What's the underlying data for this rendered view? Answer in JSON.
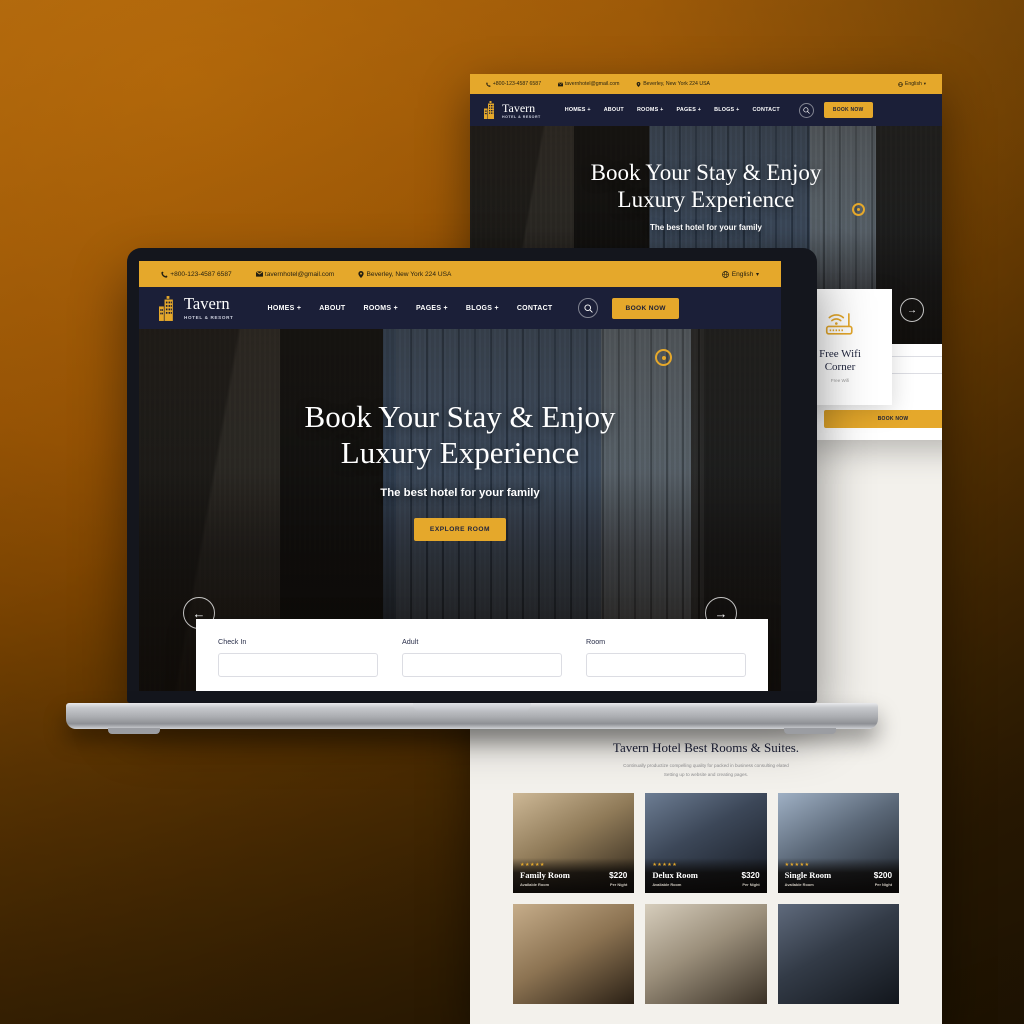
{
  "canvas": {
    "background_top": "#c8920f",
    "background_bottom": "#6b5418"
  },
  "brand": {
    "name": "Tavern",
    "tagline": "HOTEL & RESORT",
    "accent_color": "#e5a82b",
    "navy_color": "#1b1f38"
  },
  "topbar": {
    "phone": "+800-123-4587 6587",
    "email": "tavernhotel@gmail.com",
    "address": "Beverley, New York 224 USA",
    "language": "English",
    "phone_icon": "phone-icon",
    "email_icon": "envelope-icon",
    "address_icon": "map-pin-icon",
    "language_icon": "globe-icon",
    "language_caret": "chevron-down-icon"
  },
  "nav": {
    "items": [
      {
        "label": "HOMES",
        "has_submenu": true
      },
      {
        "label": "ABOUT",
        "has_submenu": false
      },
      {
        "label": "ROOMS",
        "has_submenu": true
      },
      {
        "label": "PAGES",
        "has_submenu": true
      },
      {
        "label": "BLOGS",
        "has_submenu": true
      },
      {
        "label": "CONTACT",
        "has_submenu": false
      }
    ],
    "search_icon": "search-icon",
    "cta_label": "BOOK NOW"
  },
  "hero": {
    "title_line1": "Book Your Stay & Enjoy",
    "title_line2": "Luxury Experience",
    "subtitle": "The best hotel for your family",
    "cta_label": "EXPLORE ROOM",
    "prev_icon": "arrow-left-icon",
    "next_icon": "arrow-right-icon",
    "decor_icon": "gold-dot-icon"
  },
  "booking_form": {
    "fields": [
      {
        "label": "Check In",
        "value": ""
      },
      {
        "label": "Adult",
        "value": ""
      },
      {
        "label": "Room",
        "value": ""
      }
    ],
    "cta_label": "BOOK NOW",
    "select_caret_icon": "chevron-down-icon"
  },
  "feature_card": {
    "icon": "wifi-router-icon",
    "title_line1": "Free Wifi",
    "title_line2": "Corner",
    "subtitle": "Free Wifi"
  },
  "rooms_section": {
    "title": "Tavern Hotel Best Rooms & Suites.",
    "subtitle_line1": "Continually productize compelling quality for packed in business consulting elated",
    "subtitle_line2": "Setting up to website and creating pages.",
    "cards": [
      {
        "stars": "★★★★★",
        "name": "Family Room",
        "availability": "Available Room",
        "price": "$220",
        "per": "Per Night"
      },
      {
        "stars": "★★★★★",
        "name": "Delux Room",
        "availability": "Available Room",
        "price": "$320",
        "per": "Per Night"
      },
      {
        "stars": "★★★★★",
        "name": "Single Room",
        "availability": "Available Room",
        "price": "$200",
        "per": "Per Night"
      }
    ],
    "cards_row2": [
      {
        "name": "",
        "price": ""
      },
      {
        "name": "",
        "price": ""
      },
      {
        "name": "",
        "price": ""
      }
    ]
  }
}
